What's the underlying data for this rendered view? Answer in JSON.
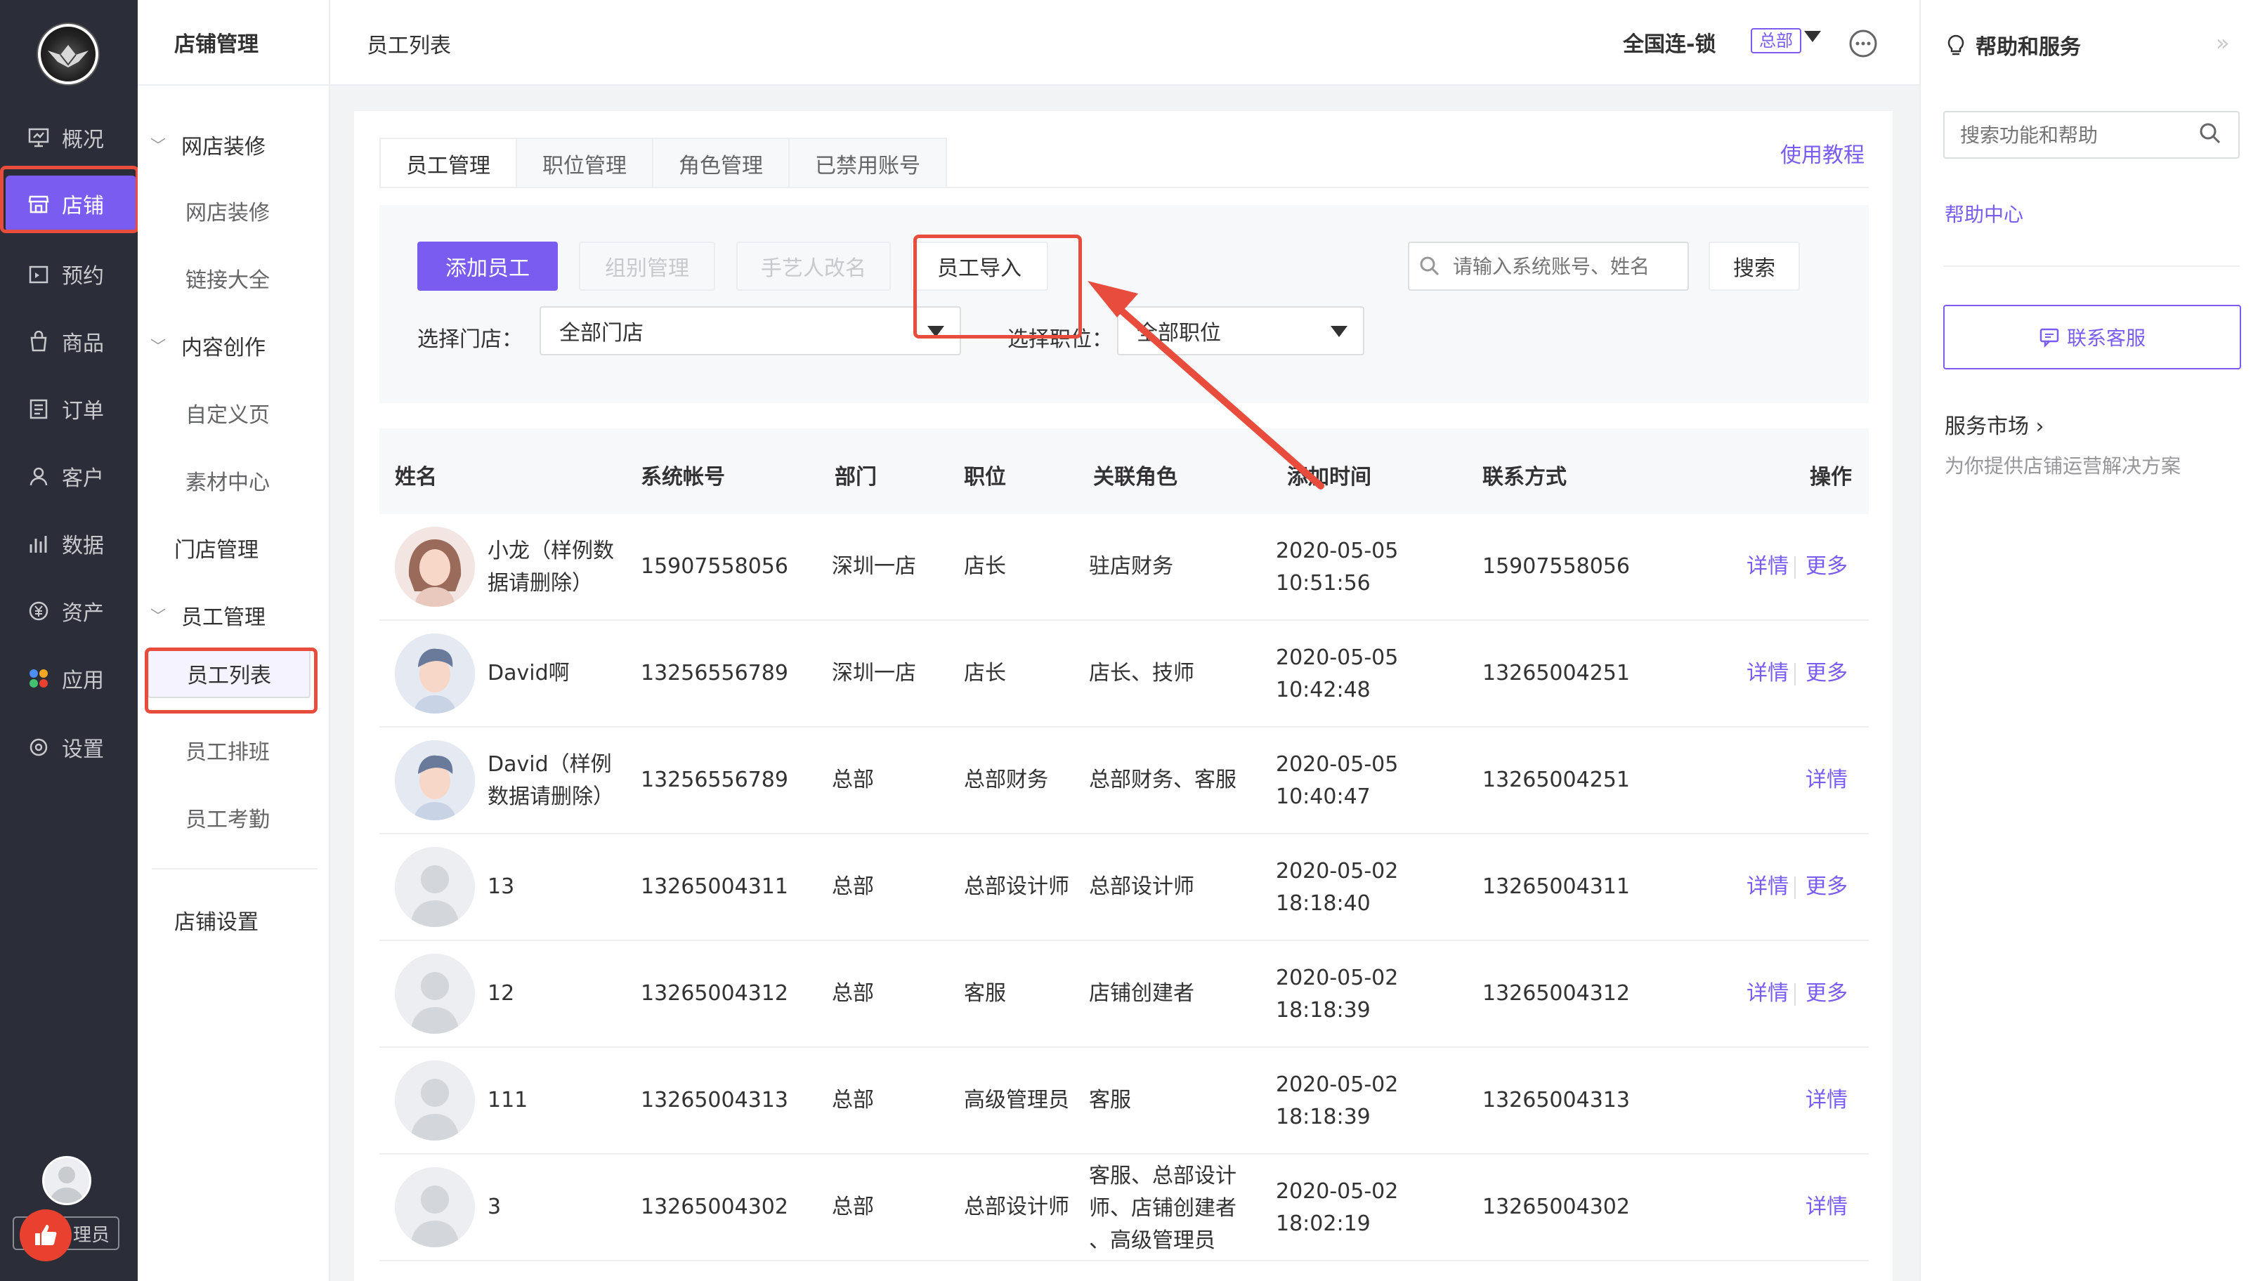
{
  "nav": {
    "items": [
      {
        "label": "概况",
        "icon": "overview-icon"
      },
      {
        "label": "店铺",
        "icon": "shop-icon"
      },
      {
        "label": "预约",
        "icon": "calendar-icon"
      },
      {
        "label": "商品",
        "icon": "bag-icon"
      },
      {
        "label": "订单",
        "icon": "order-icon"
      },
      {
        "label": "客户",
        "icon": "user-icon"
      },
      {
        "label": "数据",
        "icon": "chart-icon"
      },
      {
        "label": "资产",
        "icon": "yen-icon"
      },
      {
        "label": "应用",
        "icon": "apps-icon"
      },
      {
        "label": "设置",
        "icon": "settings-icon"
      }
    ],
    "role": "理员"
  },
  "subnav": {
    "title": "店铺管理",
    "groups": [
      "网店装修",
      "内容创作",
      "员工管理"
    ],
    "items": [
      "网店装修",
      "链接大全",
      "自定义页",
      "素材中心",
      "门店管理",
      "员工列表",
      "员工排班",
      "员工考勤",
      "店铺设置"
    ]
  },
  "header": {
    "title": "员工列表",
    "shop": "全国连-锁",
    "badge": "总部"
  },
  "help": {
    "title": "帮助和服务",
    "close": "»",
    "search_placeholder": "搜索功能和帮助",
    "center": "帮助中心",
    "contact": "联系客服",
    "market": "服务市场 ›",
    "market_desc": "为你提供店铺运营解决方案"
  },
  "tabs": [
    "员工管理",
    "职位管理",
    "角色管理",
    "已禁用账号"
  ],
  "tutorial": "使用教程",
  "filter": {
    "add": "添加员工",
    "group": "组别管理",
    "rename": "手艺人改名",
    "import": "员工导入",
    "search_placeholder": "请输入系统账号、姓名",
    "search": "搜索",
    "store_label": "选择门店：",
    "store_value": "全部门店",
    "position_label": "选择职位：",
    "position_value": "全部职位"
  },
  "table": {
    "headers": [
      "姓名",
      "系统帐号",
      "部门",
      "职位",
      "关联角色",
      "添加时间",
      "联系方式",
      "操作"
    ],
    "detail": "详情",
    "more": "更多",
    "rows": [
      {
        "name": [
          "小龙（样例数",
          "据请删除）"
        ],
        "account": "15907558056",
        "dept": "深圳一店",
        "pos": "店长",
        "roles": [
          "驻店财务"
        ],
        "date": "2020-05-05",
        "time": "10:51:56",
        "phone": "15907558056",
        "more": true,
        "avatar": "female"
      },
      {
        "name": [
          "David啊"
        ],
        "account": "13256556789",
        "dept": "深圳一店",
        "pos": "店长",
        "roles": [
          "店长、技师"
        ],
        "date": "2020-05-05",
        "time": "10:42:48",
        "phone": "13265004251",
        "more": true,
        "avatar": "male"
      },
      {
        "name": [
          "David（样例",
          "数据请删除）"
        ],
        "account": "13256556789",
        "dept": "总部",
        "pos": "总部财务",
        "roles": [
          "总部财务、客服"
        ],
        "date": "2020-05-05",
        "time": "10:40:47",
        "phone": "13265004251",
        "more": false,
        "avatar": "male"
      },
      {
        "name": [
          "13"
        ],
        "account": "13265004311",
        "dept": "总部",
        "pos": "总部设计师",
        "roles": [
          "总部设计师"
        ],
        "date": "2020-05-02",
        "time": "18:18:40",
        "phone": "13265004311",
        "more": true,
        "avatar": "default"
      },
      {
        "name": [
          "12"
        ],
        "account": "13265004312",
        "dept": "总部",
        "pos": "客服",
        "roles": [
          "店铺创建者"
        ],
        "date": "2020-05-02",
        "time": "18:18:39",
        "phone": "13265004312",
        "more": true,
        "avatar": "default"
      },
      {
        "name": [
          "111"
        ],
        "account": "13265004313",
        "dept": "总部",
        "pos": "高级管理员",
        "roles": [
          "客服"
        ],
        "date": "2020-05-02",
        "time": "18:18:39",
        "phone": "13265004313",
        "more": false,
        "avatar": "default"
      },
      {
        "name": [
          "3"
        ],
        "account": "13265004302",
        "dept": "总部",
        "pos": "总部设计师",
        "roles": [
          "客服、总部设计",
          "师、店铺创建者",
          "、高级管理员"
        ],
        "date": "2020-05-02",
        "time": "18:02:19",
        "phone": "13265004302",
        "more": false,
        "avatar": "default"
      }
    ]
  },
  "colors": {
    "accent": "#7b5cf0",
    "highlight": "#e84c3d",
    "nav_bg": "#2b2d38"
  }
}
